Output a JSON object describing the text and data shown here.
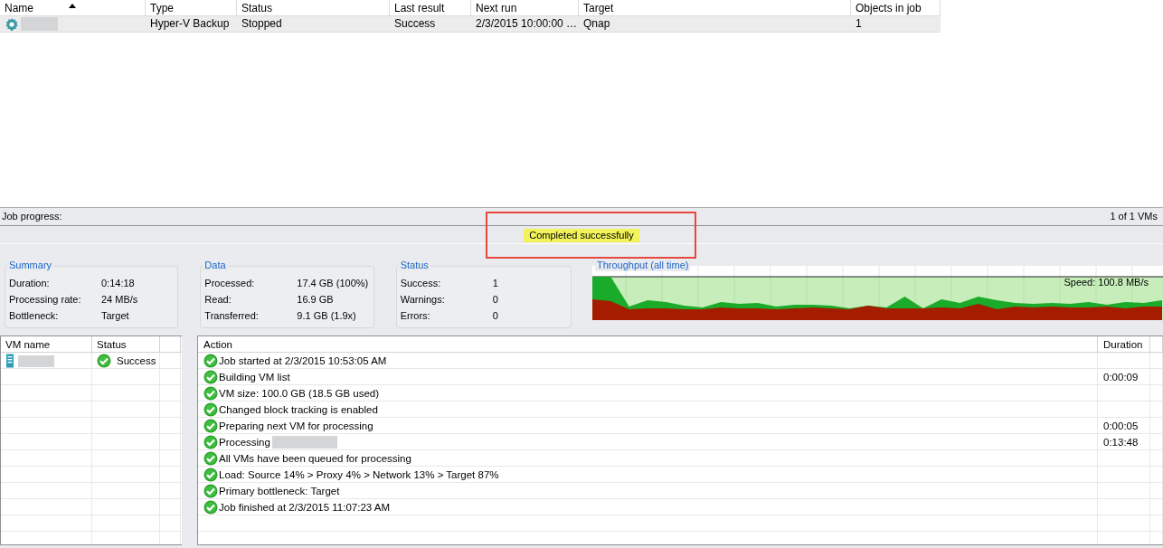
{
  "jobs_table": {
    "columns": [
      {
        "label": "Name",
        "sorted": true
      },
      {
        "label": "Type",
        "sorted": false
      },
      {
        "label": "Status",
        "sorted": false
      },
      {
        "label": "Last result",
        "sorted": false
      },
      {
        "label": "Next run",
        "sorted": false
      },
      {
        "label": "Target",
        "sorted": false
      },
      {
        "label": "Objects in job",
        "sorted": false
      }
    ],
    "rows": [
      {
        "cells": [
          "",
          "Hyper-V Backup",
          "Stopped",
          "Success",
          "2/3/2015 10:00:00 …",
          "Qnap",
          "1"
        ],
        "selected": true
      }
    ]
  },
  "job_progress": {
    "label": "Job progress:",
    "count": "1 of 1 VMs",
    "status": "Completed successfully",
    "level": 1,
    "highlighted": true
  },
  "panels": [
    {
      "title": "Summary",
      "rows": [
        {
          "label": "Duration:",
          "value": "0:14:18"
        },
        {
          "label": "Processing rate:",
          "value": "24 MB/s"
        },
        {
          "label": "Bottleneck:",
          "value": "Target"
        }
      ]
    },
    {
      "title": "Data",
      "rows": [
        {
          "label": "Processed:",
          "value": "17.4 GB (100%)"
        },
        {
          "label": "Read:",
          "value": "16.9 GB"
        },
        {
          "label": "Transferred:",
          "value": "9.1 GB (1.9x)"
        }
      ]
    },
    {
      "title": "Status",
      "rows": [
        {
          "label": "Success:",
          "value": "1"
        },
        {
          "label": "Warnings:",
          "value": "0"
        },
        {
          "label": "Errors:",
          "value": "0"
        }
      ]
    }
  ],
  "throughput": {
    "title": "Throughput (all time)",
    "speed": "Speed: 100.8 MB/s"
  },
  "vm_table": {
    "columns": [
      "VM name",
      "Status"
    ],
    "rows": [
      {
        "status": "Success"
      }
    ]
  },
  "action_log": {
    "columns": [
      "Action",
      "Duration"
    ],
    "rows": [
      {
        "action": "Job started at 2/3/2015 10:53:05 AM"
      },
      {
        "action": "Building VM list",
        "duration": "0:00:09"
      },
      {
        "action": "VM size: 100.0 GB (18.5 GB used)"
      },
      {
        "action": "Changed block tracking is enabled"
      },
      {
        "action": "Preparing next VM for processing",
        "duration": "0:00:05"
      },
      {
        "action": "Processing",
        "duration": "0:13:48",
        "redacted": true
      },
      {
        "action": "All VMs have been queued for processing"
      },
      {
        "action": "Load: Source 14% > Proxy 4% > Network 13% > Target 87%"
      },
      {
        "action": "Primary bottleneck: Target"
      },
      {
        "action": "Job finished at 2/3/2015 11:07:23 AM"
      }
    ]
  }
}
